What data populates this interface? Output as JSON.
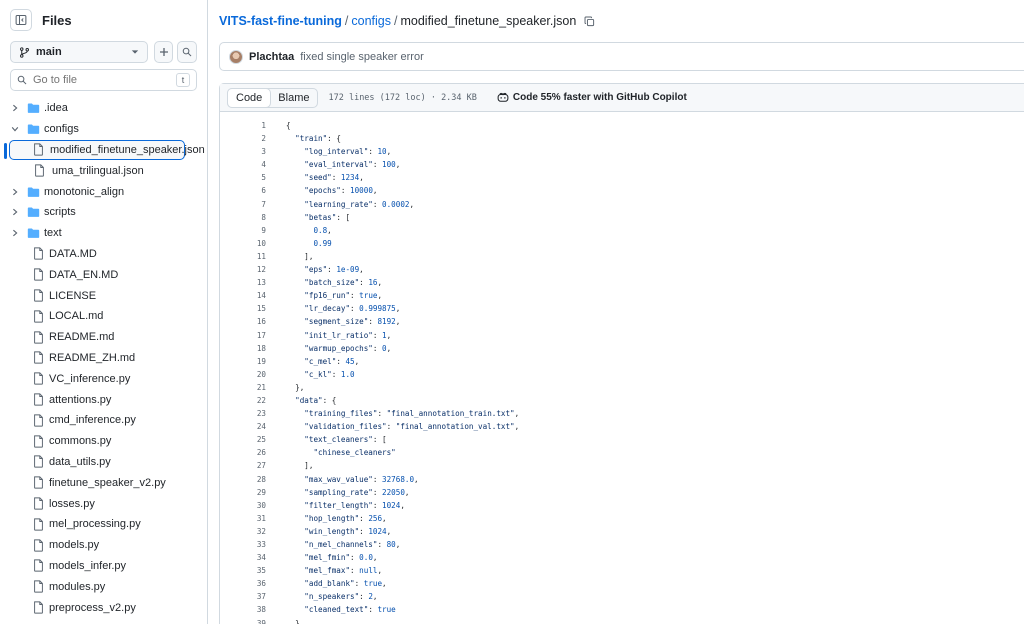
{
  "sidebar": {
    "title": "Files",
    "branch": "main",
    "search_placeholder": "Go to file",
    "search_shortcut": "t",
    "tree": [
      {
        "name": ".idea",
        "type": "folder",
        "level": 0,
        "expanded": false
      },
      {
        "name": "configs",
        "type": "folder",
        "level": 0,
        "expanded": true
      },
      {
        "name": "modified_finetune_speaker.json",
        "type": "file",
        "level": 1,
        "selected": true
      },
      {
        "name": "uma_trilingual.json",
        "type": "file",
        "level": 1
      },
      {
        "name": "monotonic_align",
        "type": "folder",
        "level": 0,
        "expanded": false
      },
      {
        "name": "scripts",
        "type": "folder",
        "level": 0,
        "expanded": false
      },
      {
        "name": "text",
        "type": "folder",
        "level": 0,
        "expanded": false
      },
      {
        "name": "DATA.MD",
        "type": "file",
        "level": 0
      },
      {
        "name": "DATA_EN.MD",
        "type": "file",
        "level": 0
      },
      {
        "name": "LICENSE",
        "type": "file",
        "level": 0
      },
      {
        "name": "LOCAL.md",
        "type": "file",
        "level": 0
      },
      {
        "name": "README.md",
        "type": "file",
        "level": 0
      },
      {
        "name": "README_ZH.md",
        "type": "file",
        "level": 0
      },
      {
        "name": "VC_inference.py",
        "type": "file",
        "level": 0
      },
      {
        "name": "attentions.py",
        "type": "file",
        "level": 0
      },
      {
        "name": "cmd_inference.py",
        "type": "file",
        "level": 0
      },
      {
        "name": "commons.py",
        "type": "file",
        "level": 0
      },
      {
        "name": "data_utils.py",
        "type": "file",
        "level": 0
      },
      {
        "name": "finetune_speaker_v2.py",
        "type": "file",
        "level": 0
      },
      {
        "name": "losses.py",
        "type": "file",
        "level": 0
      },
      {
        "name": "mel_processing.py",
        "type": "file",
        "level": 0
      },
      {
        "name": "models.py",
        "type": "file",
        "level": 0
      },
      {
        "name": "models_infer.py",
        "type": "file",
        "level": 0
      },
      {
        "name": "modules.py",
        "type": "file",
        "level": 0
      },
      {
        "name": "preprocess_v2.py",
        "type": "file",
        "level": 0
      }
    ]
  },
  "breadcrumb": {
    "repo": "VITS-fast-fine-tuning",
    "folder": "configs",
    "file": "modified_finetune_speaker.json",
    "sep": "/"
  },
  "commit": {
    "author": "Plachtaa",
    "message": "fixed single speaker error"
  },
  "file_header": {
    "tab_code": "Code",
    "tab_blame": "Blame",
    "meta": "172 lines (172 loc) · 2.34 KB",
    "copilot": "Code 55% faster with GitHub Copilot"
  },
  "code_lines": [
    "{",
    "  \"train\": {",
    "    \"log_interval\": 10,",
    "    \"eval_interval\": 100,",
    "    \"seed\": 1234,",
    "    \"epochs\": 10000,",
    "    \"learning_rate\": 0.0002,",
    "    \"betas\": [",
    "      0.8,",
    "      0.99",
    "    ],",
    "    \"eps\": 1e-09,",
    "    \"batch_size\": 16,",
    "    \"fp16_run\": true,",
    "    \"lr_decay\": 0.999875,",
    "    \"segment_size\": 8192,",
    "    \"init_lr_ratio\": 1,",
    "    \"warmup_epochs\": 0,",
    "    \"c_mel\": 45,",
    "    \"c_kl\": 1.0",
    "  },",
    "  \"data\": {",
    "    \"training_files\": \"final_annotation_train.txt\",",
    "    \"validation_files\": \"final_annotation_val.txt\",",
    "    \"text_cleaners\": [",
    "      \"chinese_cleaners\"",
    "    ],",
    "    \"max_wav_value\": 32768.0,",
    "    \"sampling_rate\": 22050,",
    "    \"filter_length\": 1024,",
    "    \"hop_length\": 256,",
    "    \"win_length\": 1024,",
    "    \"n_mel_channels\": 80,",
    "    \"mel_fmin\": 0.0,",
    "    \"mel_fmax\": null,",
    "    \"add_blank\": true,",
    "    \"n_speakers\": 2,",
    "    \"cleaned_text\": true",
    "  },"
  ],
  "colors": {
    "accent": "#0969da",
    "folder": "#54aeff",
    "string": "#0a3069",
    "number": "#0550ae",
    "border": "#d1d9e0",
    "muted": "#59636e"
  }
}
